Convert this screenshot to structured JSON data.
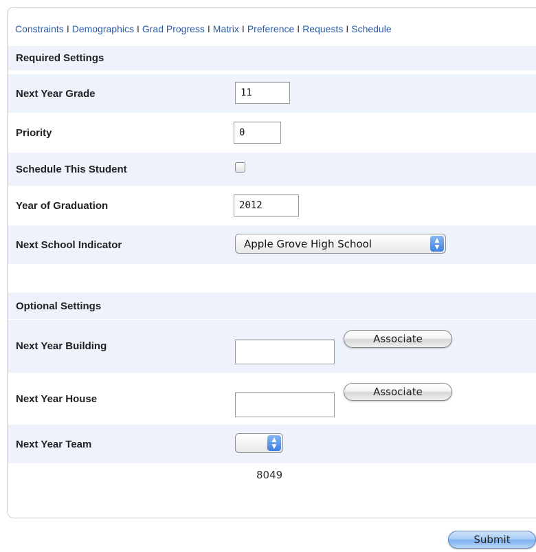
{
  "nav": {
    "links": [
      "Constraints",
      "Demographics",
      "Grad Progress",
      "Matrix",
      "Preference",
      "Requests",
      "Schedule"
    ],
    "separator": "I"
  },
  "required": {
    "heading": "Required Settings",
    "next_year_grade": {
      "label": "Next Year Grade",
      "value": "11"
    },
    "priority": {
      "label": "Priority",
      "value": "0"
    },
    "schedule_this_student": {
      "label": "Schedule This Student",
      "checked": false
    },
    "year_of_graduation": {
      "label": "Year of Graduation",
      "value": "2012"
    },
    "next_school_indicator": {
      "label": "Next School Indicator",
      "selected": "Apple Grove High School"
    }
  },
  "optional": {
    "heading": "Optional Settings",
    "next_year_building": {
      "label": "Next Year Building",
      "value": "",
      "button": "Associate"
    },
    "next_year_house": {
      "label": "Next Year House",
      "value": "",
      "button": "Associate"
    },
    "next_year_team": {
      "label": "Next Year Team",
      "selected": ""
    }
  },
  "footer_number": "8049",
  "submit_label": "Submit",
  "colors": {
    "link": "#2a5aa8",
    "row_shade": "#eef2fb",
    "select_accent": "#3d7fe0"
  },
  "icons": {
    "select_arrows": "up-down-arrows-icon"
  }
}
